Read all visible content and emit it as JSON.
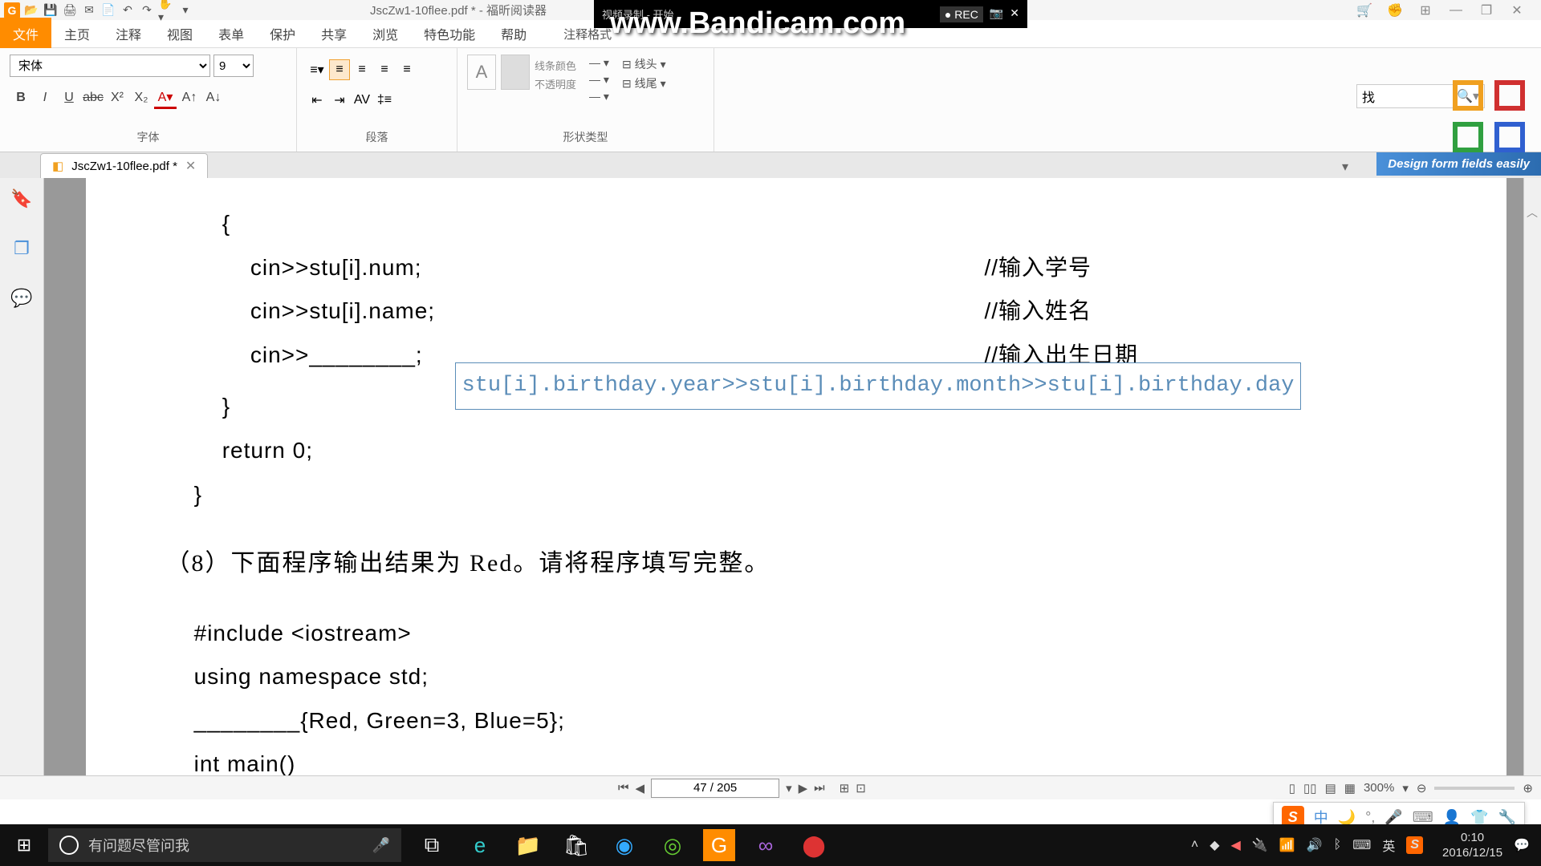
{
  "titlebar": {
    "title": "JscZw1-10flee.pdf * - 福昕阅读器"
  },
  "bandicam": {
    "watermark": "www.Bandicam.com",
    "status": "视频录制 - 开始",
    "rec": "● REC"
  },
  "menu": {
    "file": "文件",
    "home": "主页",
    "annotate": "注释",
    "view": "视图",
    "form": "表单",
    "protect": "保护",
    "share": "共享",
    "browse": "浏览",
    "special": "特色功能",
    "help": "帮助",
    "anno_format": "注释格式"
  },
  "ribbon": {
    "font_name": "宋体",
    "font_size": "9",
    "group_font": "字体",
    "group_para": "段落",
    "group_shape": "形状类型",
    "line_color": "线条颜色",
    "opacity": "不透明度",
    "line_head": "线头",
    "line_tail": "线尾",
    "search_hint": "找"
  },
  "tab": {
    "name": "JscZw1-10flee.pdf *"
  },
  "promo": "Design form fields easily",
  "doc": {
    "l1": "        {",
    "l2": "            cin>>stu[i].num;",
    "c2": "//输入学号",
    "l3": "            cin>>stu[i].name;",
    "c3": "//输入姓名",
    "l4": "            cin>>________;",
    "c4": "//输入出生日期",
    "annotation": "stu[i].birthday.year>>stu[i].birthday.month>>stu[i].birthday.day",
    "l5": "        }",
    "l6": "        return 0;",
    "l7": "    }",
    "heading": "（8）下面程序输出结果为 Red。请将程序填写完整。",
    "l8": "    #include <iostream>",
    "l9": "    using namespace std;",
    "l10": "    ________{Red, Green=3, Blue=5};",
    "l11": "    int main()"
  },
  "status": {
    "page": "47 / 205",
    "zoom": "300%"
  },
  "ime": {
    "lang": "中"
  },
  "taskbar": {
    "cortana": "有问题尽管问我",
    "time": "0:10",
    "date": "2016/12/15",
    "ime1": "英"
  }
}
